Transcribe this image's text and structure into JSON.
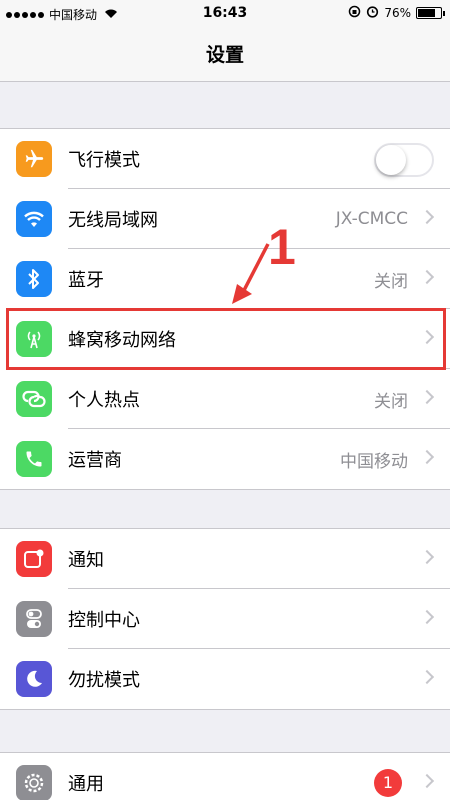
{
  "status_bar": {
    "carrier": "中国移动",
    "time": "16:43",
    "battery_percent": "76%",
    "battery_level": 0.76
  },
  "nav": {
    "title": "设置"
  },
  "groups": [
    {
      "rows": [
        {
          "label": "飞行模式",
          "icon": "airplane-icon",
          "icon_color": "#f79a1e",
          "control": "toggle",
          "toggle_on": false
        },
        {
          "label": "无线局域网",
          "icon": "wifi-icon",
          "icon_color": "#1e88f5",
          "value": "JX-CMCC"
        },
        {
          "label": "蓝牙",
          "icon": "bluetooth-icon",
          "icon_color": "#1e88f5",
          "value": "关闭"
        },
        {
          "label": "蜂窝移动网络",
          "icon": "cellular-icon",
          "icon_color": "#4cd964",
          "value": ""
        },
        {
          "label": "个人热点",
          "icon": "hotspot-icon",
          "icon_color": "#4cd964",
          "value": "关闭"
        },
        {
          "label": "运营商",
          "icon": "phone-icon",
          "icon_color": "#4cd964",
          "value": "中国移动"
        }
      ]
    },
    {
      "rows": [
        {
          "label": "通知",
          "icon": "notification-icon",
          "icon_color": "#f23b3b"
        },
        {
          "label": "控制中心",
          "icon": "control-center-icon",
          "icon_color": "#8e8e93"
        },
        {
          "label": "勿扰模式",
          "icon": "moon-icon",
          "icon_color": "#5856d6"
        }
      ]
    },
    {
      "rows": [
        {
          "label": "通用",
          "icon": "gear-icon",
          "icon_color": "#8e8e93",
          "badge": "1",
          "badge_color": "#f23b3b"
        }
      ]
    }
  ],
  "annotation": {
    "number": "1",
    "color": "#e53935"
  }
}
